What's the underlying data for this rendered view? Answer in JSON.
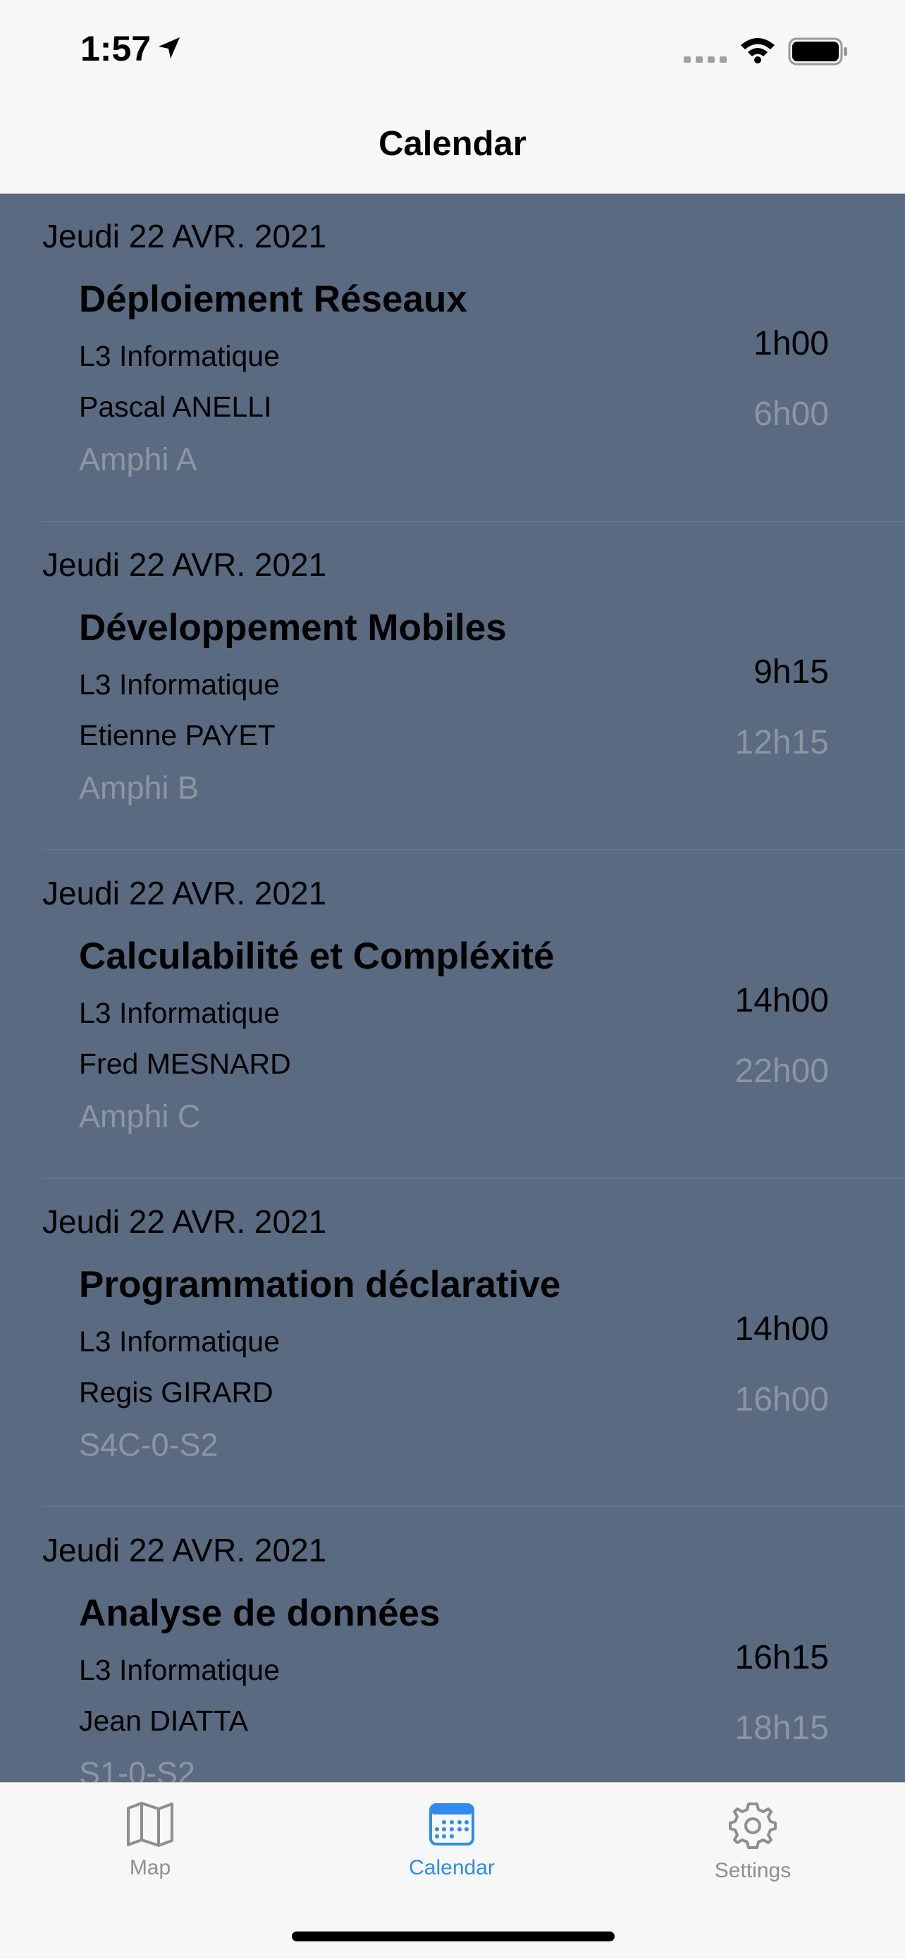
{
  "status_bar": {
    "time": "1:57",
    "location_icon": "location-arrow-icon",
    "signal_icon": "cellular-signal-icon",
    "wifi_icon": "wifi-icon",
    "battery_icon": "battery-full-icon"
  },
  "nav": {
    "title": "Calendar"
  },
  "events": [
    {
      "date": "Jeudi 22 AVR. 2021",
      "course": "Déploiement Réseaux",
      "group": "L3 Informatique",
      "teacher": "Pascal ANELLI",
      "room": "Amphi A",
      "start": "1h00",
      "end": "6h00"
    },
    {
      "date": "Jeudi 22 AVR. 2021",
      "course": "Développement Mobiles",
      "group": "L3 Informatique",
      "teacher": "Etienne PAYET",
      "room": "Amphi B",
      "start": "9h15",
      "end": "12h15"
    },
    {
      "date": "Jeudi 22 AVR. 2021",
      "course": "Calculabilité et Compléxité",
      "group": "L3 Informatique",
      "teacher": "Fred MESNARD",
      "room": "Amphi C",
      "start": "14h00",
      "end": "22h00"
    },
    {
      "date": "Jeudi 22 AVR. 2021",
      "course": "Programmation déclarative",
      "group": "L3 Informatique",
      "teacher": "Regis GIRARD",
      "room": "S4C-0-S2",
      "start": "14h00",
      "end": "16h00"
    },
    {
      "date": "Jeudi 22 AVR. 2021",
      "course": "Analyse de données",
      "group": "L3 Informatique",
      "teacher": "Jean DIATTA",
      "room": "S1-0-S2",
      "start": "16h15",
      "end": "18h15"
    }
  ],
  "tabs": [
    {
      "label": "Map",
      "icon": "map-icon",
      "active": false
    },
    {
      "label": "Calendar",
      "icon": "calendar-icon",
      "active": true
    },
    {
      "label": "Settings",
      "icon": "gear-icon",
      "active": false
    }
  ],
  "colors": {
    "list_background": "#5a6a80",
    "bar_background": "#f7f7f7",
    "accent": "#2f8bf0",
    "inactive_tab": "#8e8e93",
    "secondary_text": "#8e95a0"
  }
}
